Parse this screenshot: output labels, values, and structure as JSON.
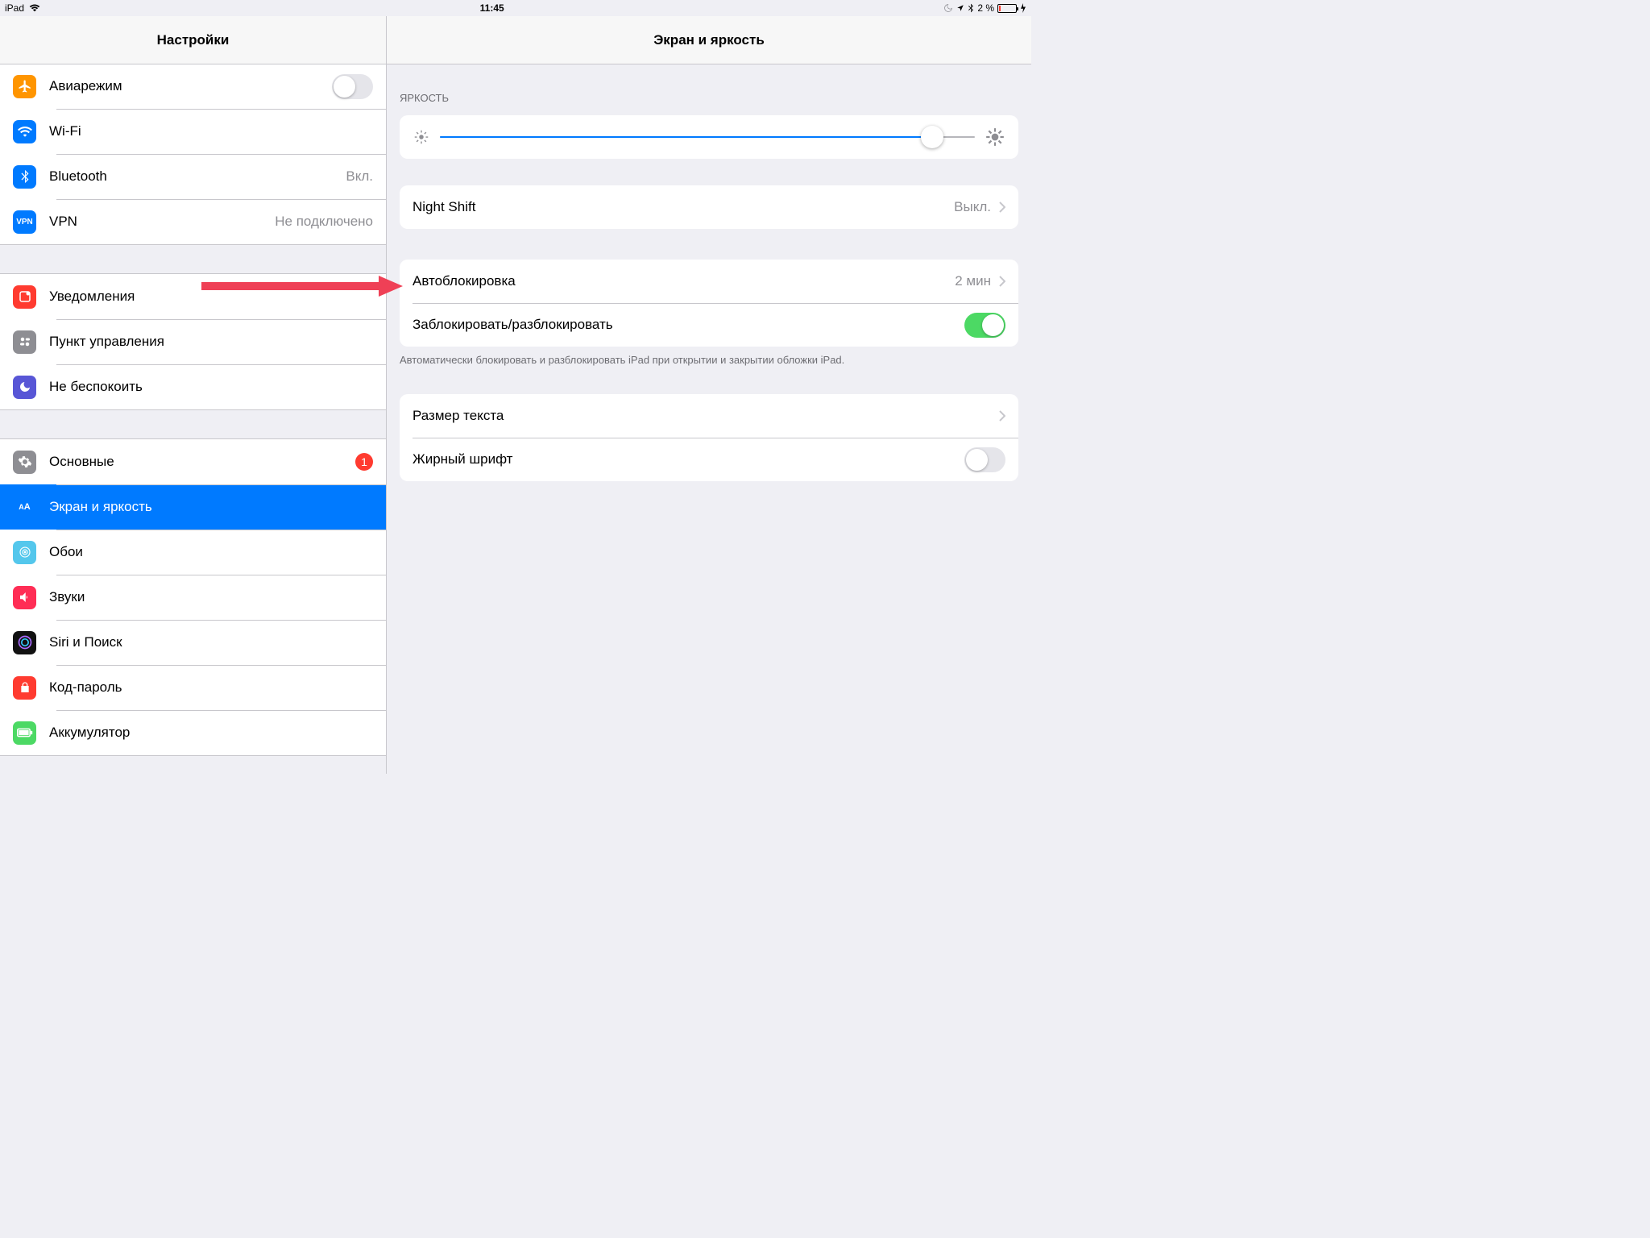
{
  "statusbar": {
    "device": "iPad",
    "time": "11:45",
    "battery_pct": "2 %"
  },
  "sidebar": {
    "title": "Настройки",
    "groups": [
      {
        "items": [
          {
            "label": "Авиарежим",
            "toggle": false
          },
          {
            "label": "Wi-Fi",
            "value": ""
          },
          {
            "label": "Bluetooth",
            "value": "Вкл."
          },
          {
            "label": "VPN",
            "value": "Не подключено"
          }
        ]
      },
      {
        "items": [
          {
            "label": "Уведомления"
          },
          {
            "label": "Пункт управления"
          },
          {
            "label": "Не беспокоить"
          }
        ]
      },
      {
        "items": [
          {
            "label": "Основные",
            "badge": "1"
          },
          {
            "label": "Экран и яркость",
            "selected": true
          },
          {
            "label": "Обои"
          },
          {
            "label": "Звуки"
          },
          {
            "label": "Siri и Поиск"
          },
          {
            "label": "Код-пароль"
          },
          {
            "label": "Аккумулятор"
          }
        ]
      }
    ]
  },
  "detail": {
    "title": "Экран и яркость",
    "brightness_header": "ЯРКОСТЬ",
    "brightness_pct": 92,
    "nightshift_label": "Night Shift",
    "nightshift_value": "Выкл.",
    "autolock_label": "Автоблокировка",
    "autolock_value": "2 мин",
    "lockunlock_label": "Заблокировать/разблокировать",
    "lockunlock_on": true,
    "lockunlock_footer": "Автоматически блокировать и разблокировать iPad при открытии и закрытии обложки iPad.",
    "textsize_label": "Размер текста",
    "bold_label": "Жирный шрифт",
    "bold_on": false
  },
  "icons": {
    "vpn_text": "VPN",
    "aa_text": "AA"
  }
}
